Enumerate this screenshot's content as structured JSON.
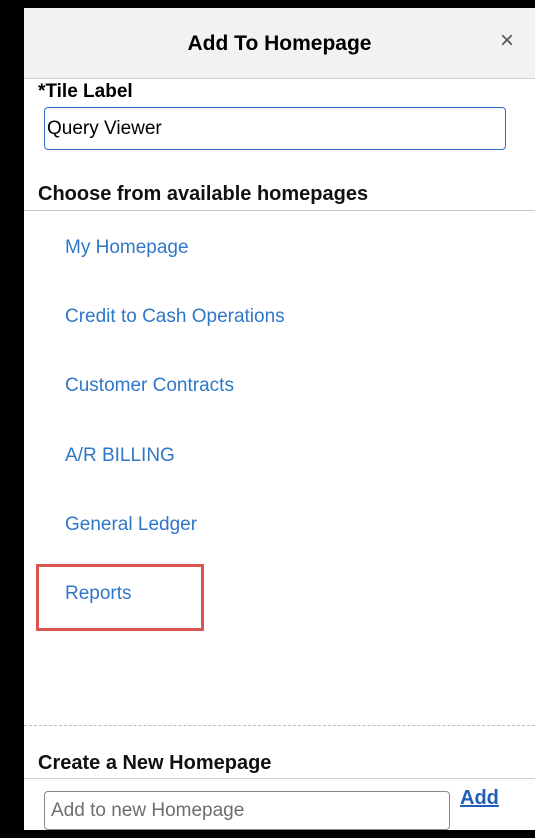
{
  "dialog": {
    "title": "Add To Homepage",
    "close_glyph": "×",
    "close_icon": "close-icon"
  },
  "tile": {
    "label": "*Tile Label",
    "value": "Query Viewer"
  },
  "choose_section": {
    "title": "Choose from available homepages",
    "items": [
      {
        "label": "My Homepage"
      },
      {
        "label": "Credit to Cash Operations"
      },
      {
        "label": "Customer Contracts"
      },
      {
        "label": "A/R BILLING"
      },
      {
        "label": "General Ledger"
      },
      {
        "label": "Reports",
        "highlighted": true
      }
    ]
  },
  "create_section": {
    "title": "Create a New Homepage",
    "placeholder": "Add to new Homepage",
    "add_label": "Add"
  },
  "colors": {
    "link": "#2f77c8",
    "highlight": "#d9534f",
    "header_bg": "#f2f2f2",
    "input_border": "#2e6ec7"
  }
}
